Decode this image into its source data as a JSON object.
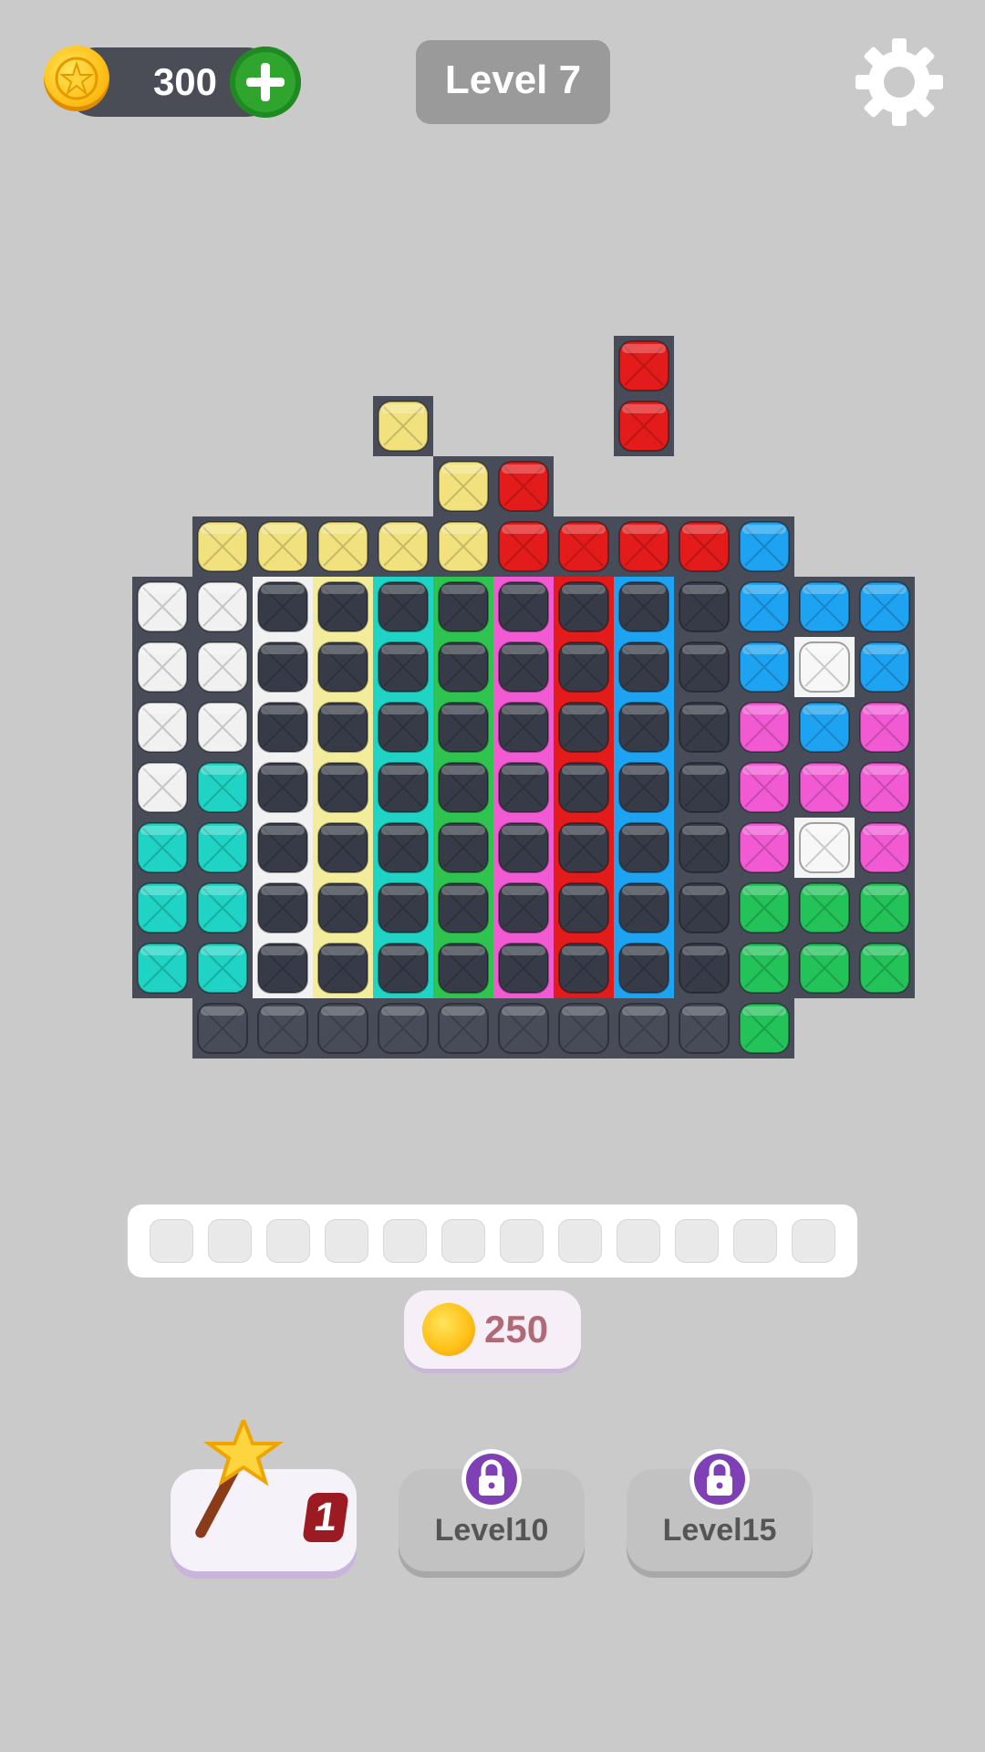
{
  "coins": {
    "value": "300"
  },
  "level": {
    "label": "Level 7"
  },
  "board": {
    "colors": {
      "y": "#f2e27e",
      "r": "#e31b1b",
      "b": "#1ea3f2",
      "w": "#f1f1f1",
      "t": "#1fd4c4",
      "p": "#f25ad4",
      "g": "#23c35a",
      "d": "#363b47",
      "e": "#474c58"
    },
    "strip_colors": [
      "#f1f1f1",
      "#f3ec9b",
      "#1fd4c4",
      "#2fc450",
      "#f25ad4",
      "#e31b1b",
      "#1ea3f2"
    ],
    "rows": [
      "........r..",
      "....y..r...",
      ".....yr....",
      "...yyyyyrrrrb..",
      "..wwddddddddbbb",
      "..wwdddddddbWb",
      "..wwdddddddpbp",
      "..wtdddddddppp",
      "..ttdddddddpWp",
      "..ttdddddddggg",
      "..ttdddddddggg",
      "...eeeeeeeeeg.."
    ]
  },
  "tray": {
    "slot_count": 12
  },
  "cost": {
    "value": "250"
  },
  "boosters": [
    {
      "id": "magic-wand",
      "count": "1"
    },
    {
      "id": "locked-1",
      "label": "Level10"
    },
    {
      "id": "locked-2",
      "label": "Level15"
    }
  ]
}
